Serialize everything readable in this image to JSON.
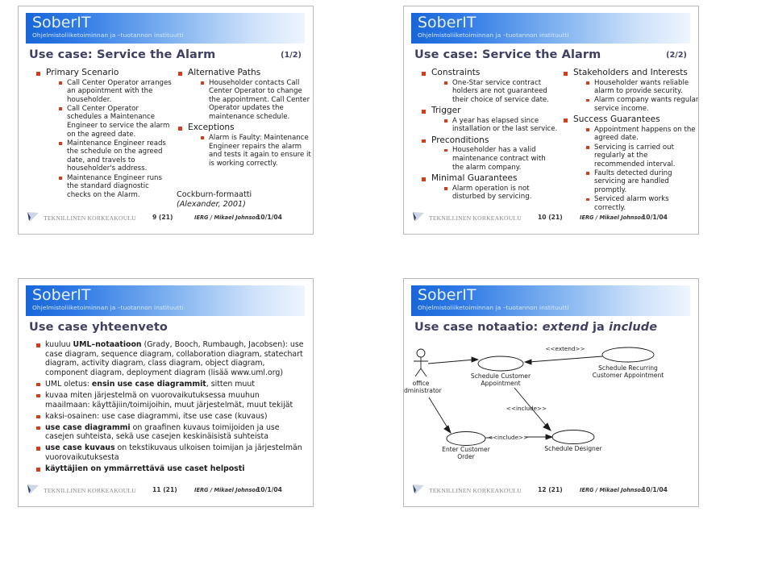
{
  "brand": {
    "name": "SoberIT",
    "subtitle": "Ohjelmistoliiketoiminnan ja –tuotannon instituutti"
  },
  "footer_common": {
    "org": "TEKNILLINEN KORKEAKOULU",
    "author": "IERG / Mikael Johnson",
    "date": "10/1/04"
  },
  "slides": [
    {
      "title": "Use case: Service the Alarm",
      "page_indicator": "(1/2)",
      "page_number": "9 (21)",
      "left_column": [
        {
          "heading": "Primary Scenario",
          "items": [
            "Call Center Operator arranges an appointment with the householder.",
            "Call Center Operator schedules a Maintenance Engineer to service the alarm on the agreed date.",
            "Maintenance Engineer reads the schedule on the agreed date, and travels to householder's address.",
            "Maintenance Engineer runs the standard diagnostic checks on the Alarm."
          ]
        }
      ],
      "right_column": [
        {
          "heading": "Alternative Paths",
          "items": [
            "Householder contacts Call Center Operator to change the appointment. Call Center Operator updates the maintenance schedule."
          ]
        },
        {
          "heading": "Exceptions",
          "items": [
            "Alarm is Faulty: Maintenance Engineer repairs the alarm and tests it again to ensure it is working correctly."
          ]
        }
      ],
      "note": {
        "line1": "Cockburn-formaatti",
        "line2": "(Alexander, 2001)"
      }
    },
    {
      "title": "Use case: Service the Alarm",
      "page_indicator": "(2/2)",
      "page_number": "10 (21)",
      "left_column": [
        {
          "heading": "Constraints",
          "items": [
            "One-Star service contract holders are not guaranteed their choice of service date."
          ]
        },
        {
          "heading": "Trigger",
          "items": [
            "A year has elapsed since installation or the last service."
          ]
        },
        {
          "heading": "Preconditions",
          "items": [
            "Householder has a valid maintenance contract with the alarm company."
          ]
        },
        {
          "heading": "Minimal Guarantees",
          "items": [
            "Alarm operation is not disturbed by servicing."
          ]
        }
      ],
      "right_column": [
        {
          "heading": "Stakeholders and Interests",
          "items": [
            "Householder wants reliable alarm to provide security.",
            "Alarm company wants regular service income."
          ]
        },
        {
          "heading": "Success Guarantees",
          "items": [
            "Appointment happens on the agreed date.",
            "Servicing is carried out regularly at the recommended interval.",
            "Faults detected during servicing are handled promptly.",
            "Serviced alarm works correctly."
          ]
        }
      ]
    },
    {
      "title": "Use case yhteenveto",
      "page_indicator": "",
      "page_number": "11 (21)",
      "bullets": [
        "kuuluu <b>UML–notaatioon</b> (Grady, Booch, Rumbaugh, Jacobsen): use case diagram, sequence diagram, collaboration diagram, statechart diagram, activity diagram, class diagram, object diagram, component diagram, deployment diagram (lisää www.uml.org)",
        "UML oletus: <b>ensin use case diagrammit</b>, sitten muut",
        "kuvaa miten järjestelmä on vuorovaikutuksessa muuhun maailmaan: käyttäjiin/toimijoihin, muut järjestelmät, muut tekijät",
        "kaksi-osainen: use case diagrammi, itse use case (kuvaus)",
        "<b>use case diagrammi</b> on graafinen kuvaus toimijoiden ja use casejen suhteista, sekä use casejen keskinäisistä suhteista",
        "<b>use case kuvaus</b> on tekstikuvaus ulkoisen toimijan ja järjestelmän vuorovaikutuksesta",
        "<b>käyttäjien on ymmärrettävä use caset helposti</b>"
      ]
    },
    {
      "title_prefix": "Use case notaatio: ",
      "title_italic_1": "extend",
      "title_mid": " ja ",
      "title_italic_2": "include",
      "page_indicator": "",
      "page_number": "12 (21)",
      "diagram": {
        "actor": {
          "line1": "office",
          "line2": "administrator"
        },
        "usecases": [
          {
            "id": "schedule-customer-appointment",
            "line1": "Schedule Customer",
            "line2": "Appointment"
          },
          {
            "id": "schedule-recurring-customer-appointment",
            "line1": "Schedule Recurring",
            "line2": "Customer Appointment"
          },
          {
            "id": "enter-customer-order",
            "line1": "Enter Customer",
            "line2": "Order"
          },
          {
            "id": "schedule-designer",
            "line1": "Schedule Designer",
            "line2": ""
          }
        ],
        "stereotypes": [
          {
            "id": "extend",
            "label": "<<extend>>"
          },
          {
            "id": "include-1",
            "label": "<<include>>"
          },
          {
            "id": "include-2",
            "label": "<<include>>"
          }
        ]
      }
    }
  ]
}
